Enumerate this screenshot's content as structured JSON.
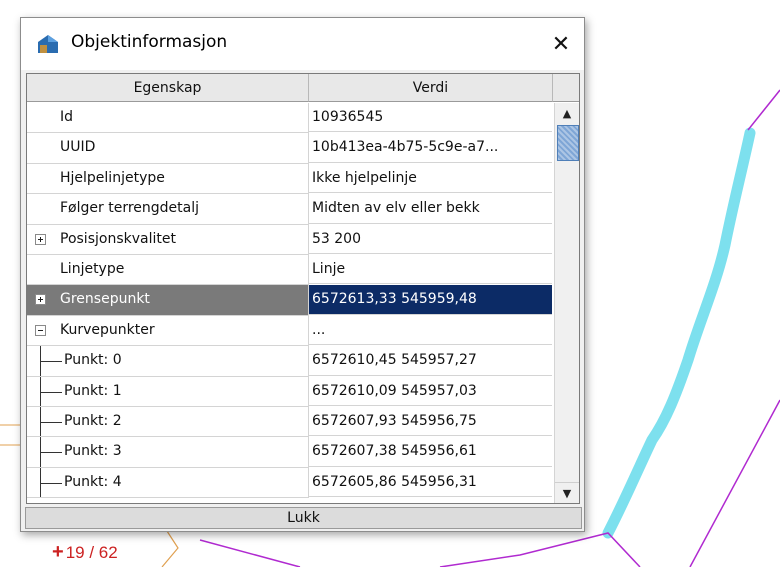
{
  "window": {
    "title": "Objektinformasjon",
    "close_glyph": "✕",
    "icon": "house-icon"
  },
  "grid": {
    "columns": [
      "Egenskap",
      "Verdi"
    ],
    "rows": [
      {
        "property": "Id",
        "value": "10936545"
      },
      {
        "property": "UUID",
        "value": "10b413ea-4b75-5c9e-a7..."
      },
      {
        "property": "Hjelpelinjetype",
        "value": "Ikke hjelpelinje"
      },
      {
        "property": "Følger terrengdetalj",
        "value": "Midten av elv eller bekk"
      },
      {
        "property": "Posisjonskvalitet",
        "value": "53  200",
        "expander": "collapsed"
      },
      {
        "property": "Linjetype",
        "value": "Linje"
      },
      {
        "property": "Grensepunkt",
        "value": "6572613,33 545959,48",
        "expander": "collapsed",
        "selected": true
      },
      {
        "property": "Kurvepunkter",
        "value": "...",
        "expander": "expanded"
      },
      {
        "property": "Punkt: 0",
        "value": "6572610,45 545957,27",
        "child": true
      },
      {
        "property": "Punkt: 1",
        "value": "6572610,09 545957,03",
        "child": true
      },
      {
        "property": "Punkt: 2",
        "value": "6572607,93 545956,75",
        "child": true
      },
      {
        "property": "Punkt: 3",
        "value": "6572607,38 545956,61",
        "child": true
      },
      {
        "property": "Punkt: 4",
        "value": "6572605,86 545956,31",
        "child": true
      }
    ]
  },
  "scrollbar": {
    "up_glyph": "▲",
    "down_glyph": "▼"
  },
  "buttons": {
    "close_label": "Lukk"
  },
  "map": {
    "label": "19 / 62",
    "marker": "+"
  },
  "colors": {
    "selected_value_bg": "#0c2b66",
    "selected_property_bg": "#7a7a7a",
    "river": "#7de0ee",
    "boundary": "#b02ad0",
    "label": "#cc2222"
  }
}
